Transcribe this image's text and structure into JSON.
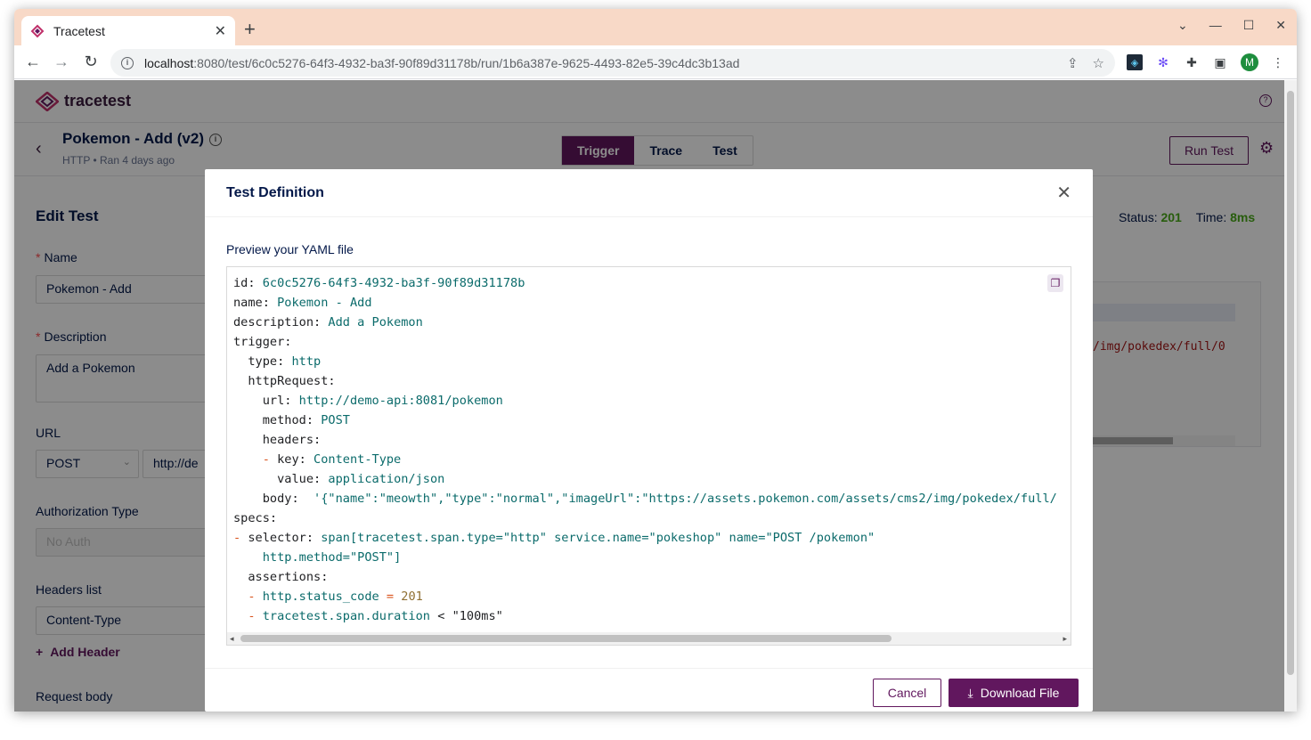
{
  "browser": {
    "tab_title": "Tracetest",
    "url_host": "localhost",
    "url_path": ":8080/test/6c0c5276-64f3-4932-ba3f-90f89d31178b/run/1b6a387e-9625-4493-82e5-39c4dc3b13ad",
    "profile_initial": "M"
  },
  "app": {
    "logo_text": "tracetest",
    "test_name": "Pokemon - Add (v2)",
    "test_meta": "HTTP • Ran 4 days ago",
    "tabs": [
      "Trigger",
      "Trace",
      "Test"
    ],
    "active_tab": "Trigger",
    "run_button": "Run Test"
  },
  "edit_panel": {
    "title": "Edit Test",
    "name_label": "Name",
    "name_value": "Pokemon - Add",
    "description_label": "Description",
    "description_value": "Add a Pokemon",
    "url_label": "URL",
    "method_value": "POST",
    "url_value": "http://de",
    "auth_label": "Authorization Type",
    "auth_value": "No Auth",
    "headers_label": "Headers list",
    "header_value": "Content-Type",
    "add_header": "Add Header",
    "request_body_label": "Request body"
  },
  "response": {
    "status_label": "Status:",
    "status_value": "201",
    "time_label": "Time:",
    "time_value": "8ms",
    "body_snippet": "/img/pokedex/full/0"
  },
  "modal": {
    "title": "Test Definition",
    "subtitle": "Preview your YAML file",
    "cancel": "Cancel",
    "download": "Download File",
    "yaml": {
      "id": "6c0c5276-64f3-4932-ba3f-90f89d31178b",
      "name": "Pokemon - Add",
      "description": "Add a Pokemon",
      "type": "http",
      "url": "http://demo-api:8081/pokemon",
      "method": "POST",
      "header_key": "Content-Type",
      "header_value": "application/json",
      "body": "'{\"name\":\"meowth\",\"type\":\"normal\",\"imageUrl\":\"https://assets.pokemon.com/assets/cms2/img/pokedex/full/",
      "selector": "span[tracetest.span.type=\"http\" service.name=\"pokeshop\" name=\"POST /pokemon\"",
      "selector_cont": "http.method=\"POST\"]",
      "assert1_field": "http.status_code",
      "assert1_op": "=",
      "assert1_value": "201",
      "assert2_field": "tracetest.span.duration",
      "assert2_op": "<",
      "assert2_value": "\"100ms\""
    }
  }
}
